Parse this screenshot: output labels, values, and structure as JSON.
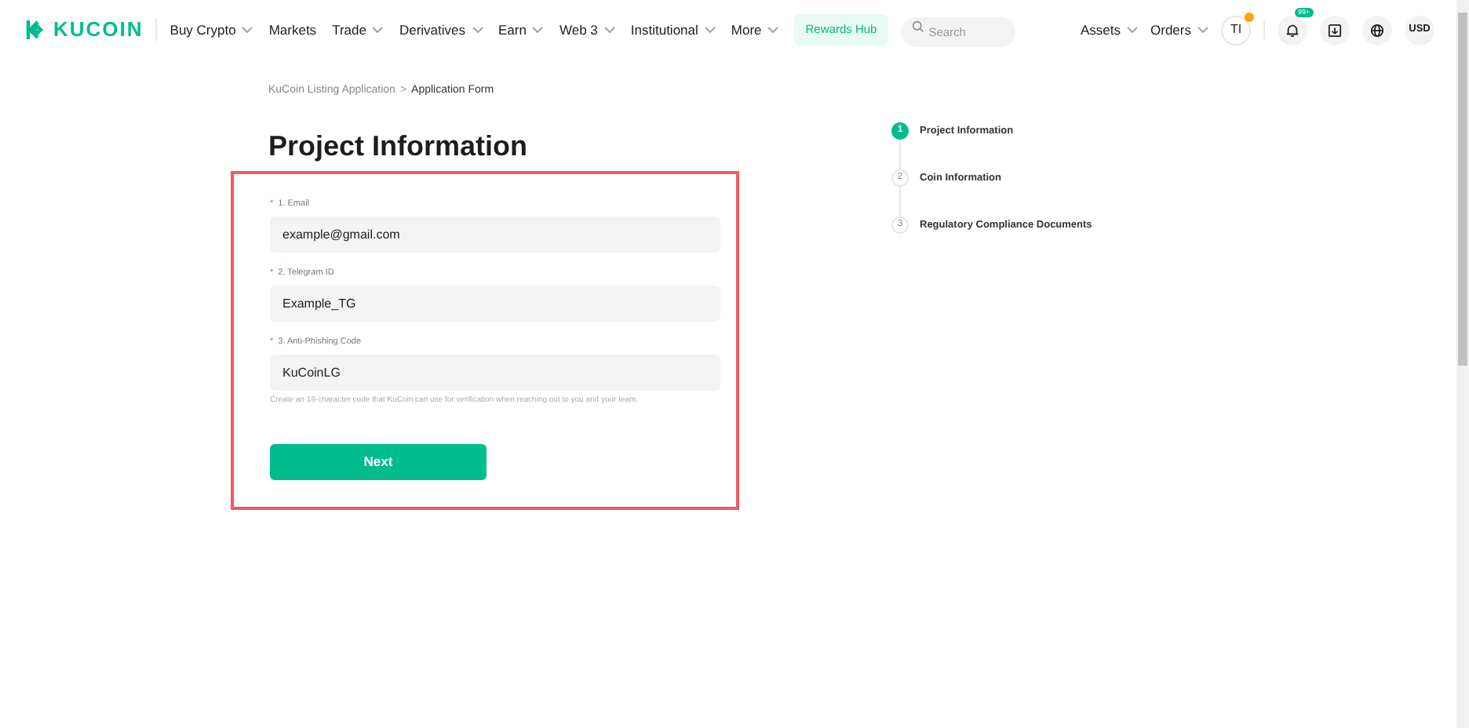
{
  "header": {
    "logo": "KUCOIN",
    "nav": [
      {
        "label": "Buy Crypto",
        "dropdown": true
      },
      {
        "label": "Markets",
        "dropdown": false
      },
      {
        "label": "Trade",
        "dropdown": true
      },
      {
        "label": "Derivatives",
        "dropdown": true
      },
      {
        "label": "Earn",
        "dropdown": true
      },
      {
        "label": "Web 3",
        "dropdown": true
      },
      {
        "label": "Institutional",
        "dropdown": true
      },
      {
        "label": "More",
        "dropdown": true
      }
    ],
    "rewards": "Rewards Hub",
    "search": {
      "placeholder": "Search"
    },
    "right_menus": [
      {
        "label": "Assets",
        "dropdown": true
      },
      {
        "label": "Orders",
        "dropdown": true
      }
    ],
    "avatar": "TI",
    "notification_badge": "99+",
    "currency": "USD"
  },
  "breadcrumb": [
    {
      "label": "KuCoin Listing Application",
      "selected": false
    },
    {
      "label": "Application Form",
      "selected": true
    }
  ],
  "breadcrumb_separator": ">",
  "title": "Project Information",
  "fields": [
    {
      "mark": "*",
      "label": "1. Email",
      "value": "example@gmail.com"
    },
    {
      "mark": "*",
      "label": "2. Telegram ID",
      "value": "Example_TG"
    },
    {
      "mark": "*",
      "label": "3. Anti-Phishing Code",
      "value": "KuCoinLG",
      "hint": "Create an 18-character code that KuCoin can use for verification when reaching out to you and your team."
    }
  ],
  "submit": "Next",
  "steps": [
    {
      "number": "1",
      "label": "Project Information",
      "selected": true
    },
    {
      "number": "2",
      "label": "Coin Information",
      "selected": false
    },
    {
      "number": "3",
      "label": "Regulatory Compliance Documents",
      "selected": false
    }
  ]
}
